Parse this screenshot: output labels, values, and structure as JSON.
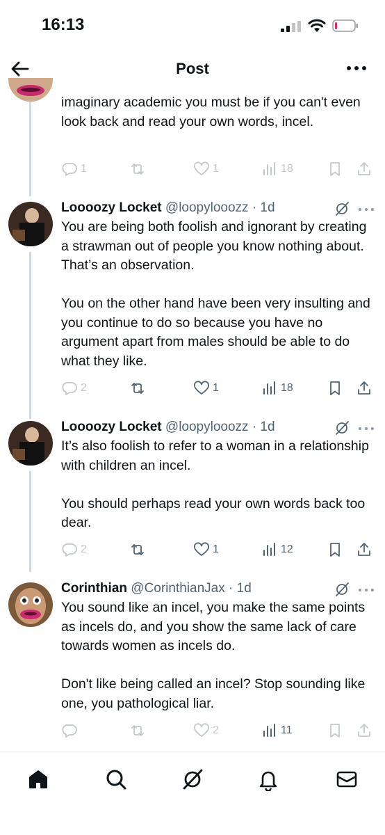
{
  "status_bar": {
    "time": "16:13"
  },
  "header": {
    "title": "Post"
  },
  "tweets": [
    {
      "text": "imaginary academic you must be if you can't even look back and read your own words, incel.",
      "replies": "1",
      "retweets": "",
      "likes": "1",
      "views": "18"
    },
    {
      "name": "Loooozy Locket",
      "handle": "@loopylooozz",
      "time": "· 1d",
      "text": "You are being both foolish and ignorant by creating a strawman out of people you know nothing about. That’s an observation.\n\nYou on the other hand have been very insulting and you continue to do so because you have no argument apart from males should be able to do what they like.",
      "replies": "2",
      "retweets": "",
      "likes": "1",
      "views": "18"
    },
    {
      "name": "Loooozy Locket",
      "handle": "@loopylooozz",
      "time": "· 1d",
      "text": "It’s also foolish to refer to a woman in a relationship with children an incel.\n\nYou should perhaps read your own words back too dear.",
      "replies": "2",
      "retweets": "",
      "likes": "1",
      "views": "12"
    },
    {
      "name": "Corinthian",
      "handle": "@CorinthianJax",
      "time": "· 1d",
      "text": "You sound like an incel, you make the same points as incels do, and you show the same lack of care towards women as incels do.\n\nDon't like being called an incel? Stop sounding like one, you pathological liar.",
      "replies": "",
      "retweets": "",
      "likes": "2",
      "views": "11"
    }
  ],
  "icons": {
    "back": "arrow-left-icon",
    "more": "more-horizontal-icon",
    "reply": "speech-bubble-icon",
    "retweet": "retweet-icon",
    "like": "heart-icon",
    "views": "bar-chart-icon",
    "bookmark": "bookmark-icon",
    "share": "share-icon",
    "grok": "grok-icon",
    "tabs": [
      "home-icon",
      "search-icon",
      "grok-icon",
      "bell-icon",
      "mail-icon"
    ]
  },
  "colors": {
    "text": "#0f1419",
    "secondary": "#536471",
    "divider": "#cfd9de"
  }
}
